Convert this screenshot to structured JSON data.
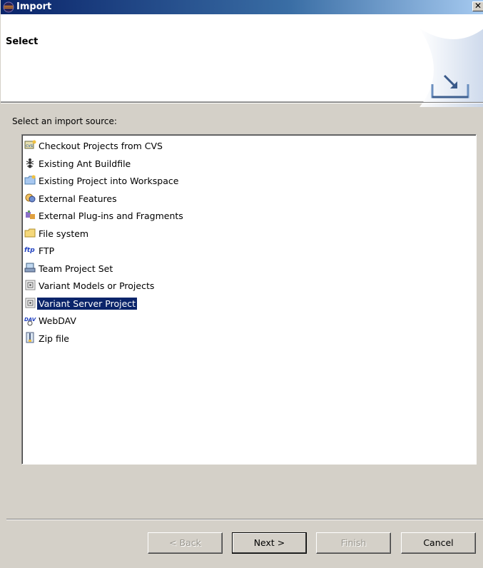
{
  "window": {
    "title": "Import"
  },
  "banner": {
    "title": "Select"
  },
  "source_label": "Select an import source:",
  "sources": [
    {
      "label": "Checkout Projects from CVS",
      "icon": "cvs-icon"
    },
    {
      "label": "Existing Ant Buildfile",
      "icon": "ant-icon"
    },
    {
      "label": "Existing Project into Workspace",
      "icon": "project-folder-icon"
    },
    {
      "label": "External Features",
      "icon": "features-icon"
    },
    {
      "label": "External Plug-ins and Fragments",
      "icon": "plugin-icon"
    },
    {
      "label": "File system",
      "icon": "folder-icon"
    },
    {
      "label": "FTP",
      "icon": "ftp-icon"
    },
    {
      "label": "Team Project Set",
      "icon": "team-icon"
    },
    {
      "label": "Variant Models or Projects",
      "icon": "variant-icon"
    },
    {
      "label": "Variant Server Project",
      "icon": "variant-server-icon"
    },
    {
      "label": "WebDAV",
      "icon": "webdav-icon"
    },
    {
      "label": "Zip file",
      "icon": "zip-icon"
    }
  ],
  "selected_index": 9,
  "buttons": {
    "back": "< Back",
    "next": "Next >",
    "finish": "Finish",
    "cancel": "Cancel"
  },
  "ftp_glyph": "ftp",
  "dav_glyph": "DAV",
  "close_glyph": "✕",
  "colors": {
    "selection": "#0a246a",
    "titlebar_start": "#0a246a",
    "dialog_bg": "#d4d0c8"
  }
}
